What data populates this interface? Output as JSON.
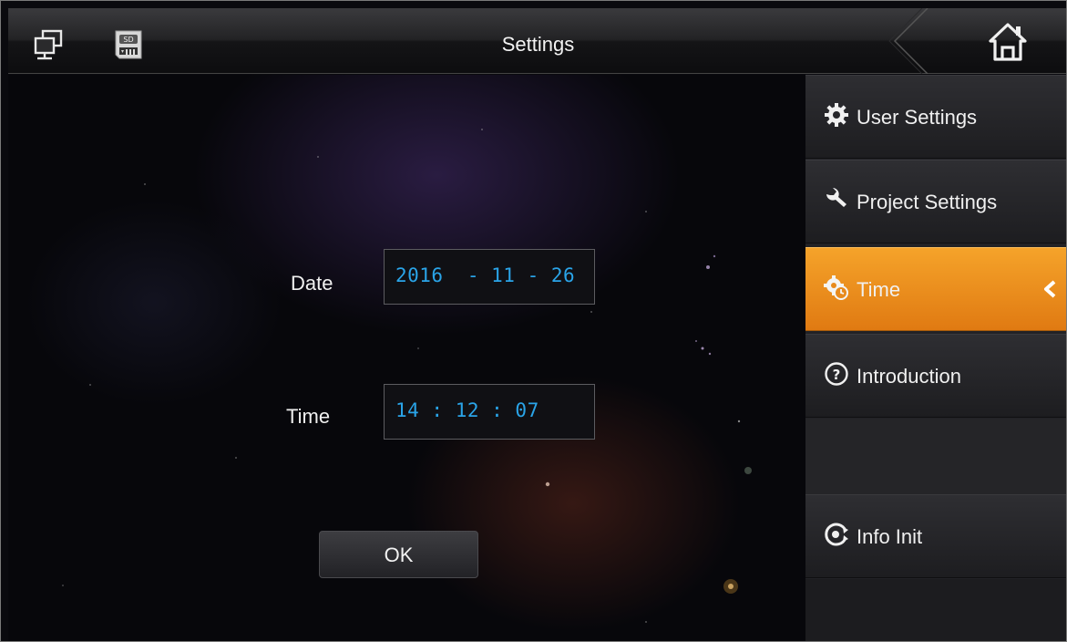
{
  "header": {
    "title": "Settings",
    "icons": [
      "network-icon",
      "sd-card-icon",
      "home-icon"
    ]
  },
  "form": {
    "date_label": "Date",
    "date_value": "2016  - 11 - 26",
    "time_label": "Time",
    "time_value": "14 : 12 : 07",
    "ok_label": "OK"
  },
  "sidebar": {
    "items": [
      {
        "label": "User Settings",
        "icon": "gear-icon",
        "active": false
      },
      {
        "label": "Project Settings",
        "icon": "wrench-icon",
        "active": false
      },
      {
        "label": "Time",
        "icon": "gear-clock-icon",
        "active": true
      },
      {
        "label": "Introduction",
        "icon": "help-circle-icon",
        "active": false
      },
      {
        "label": "Info Init",
        "icon": "reset-icon",
        "active": false
      }
    ]
  },
  "colors": {
    "accent": "#f08c1a",
    "value_text": "#2aa4e8"
  }
}
